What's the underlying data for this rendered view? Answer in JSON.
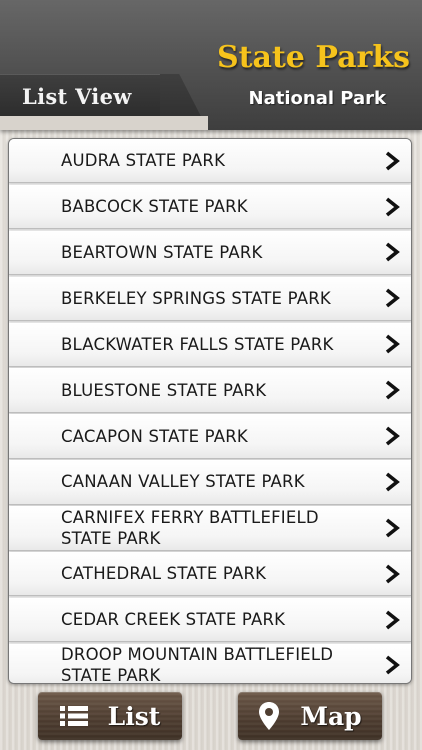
{
  "header": {
    "title": "State Parks",
    "subtitle": "National Park",
    "tab_label": "List View"
  },
  "list": {
    "items": [
      {
        "label": "AUDRA STATE PARK"
      },
      {
        "label": "BABCOCK STATE PARK"
      },
      {
        "label": "BEARTOWN STATE PARK"
      },
      {
        "label": "BERKELEY SPRINGS STATE PARK"
      },
      {
        "label": "BLACKWATER FALLS STATE PARK"
      },
      {
        "label": "BLUESTONE STATE PARK"
      },
      {
        "label": "CACAPON STATE PARK"
      },
      {
        "label": "CANAAN VALLEY STATE PARK"
      },
      {
        "label": "CARNIFEX FERRY BATTLEFIELD STATE PARK"
      },
      {
        "label": "CATHEDRAL STATE PARK"
      },
      {
        "label": "CEDAR CREEK STATE PARK"
      },
      {
        "label": "DROOP MOUNTAIN BATTLEFIELD STATE PARK"
      }
    ]
  },
  "buttons": {
    "list_label": "List",
    "map_label": "Map"
  },
  "icons": {
    "row": "chevron-right-icon",
    "list_button": "list-icon",
    "map_button": "map-pin-icon"
  },
  "colors": {
    "title": "#f6c31c",
    "header": "#505050",
    "button": "#4f3e31"
  }
}
